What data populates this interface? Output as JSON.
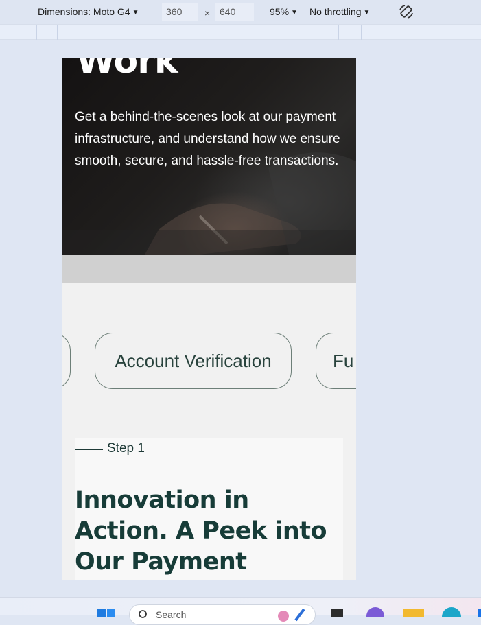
{
  "devtools": {
    "dimensions_label": "Dimensions: Moto G4",
    "width": "360",
    "times": "×",
    "height": "640",
    "zoom": "95%",
    "throttling": "No throttling",
    "caret": "▼",
    "rotate_icon": "rotate-icon"
  },
  "hero": {
    "title": "Work",
    "description": "Get a behind-the-scenes look at our payment infrastructure, and understand how we ensure smooth, secure, and hassle-free transactions."
  },
  "tabs": {
    "items": [
      {
        "label": ""
      },
      {
        "label": "Account Verification"
      },
      {
        "label": "Fu"
      }
    ]
  },
  "step": {
    "label": "Step 1",
    "heading": "Innovation in Action. A Peek into Our Payment"
  },
  "taskbar": {
    "search_placeholder": "Search"
  },
  "colors": {
    "heading_green": "#173c38",
    "pill_border": "#6d7f78",
    "devtools_bg": "#dee5f2"
  }
}
